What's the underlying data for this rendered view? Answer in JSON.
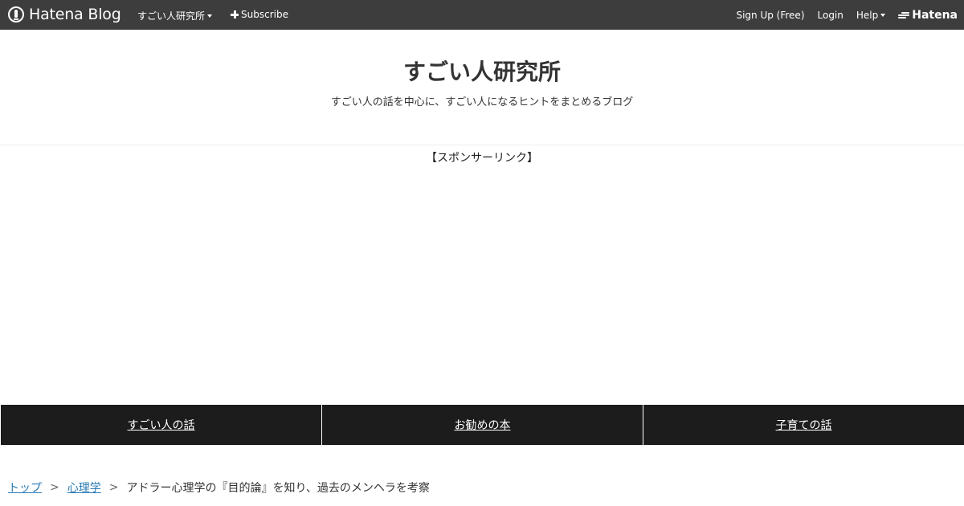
{
  "topbar": {
    "logo_text": "Hatena Blog",
    "blog_menu_label": "すごい人研究所",
    "subscribe_label": "Subscribe",
    "signup_label": "Sign Up (Free)",
    "login_label": "Login",
    "help_label": "Help",
    "hatena_label": "Hatena",
    "bg_color": "#3d3d3d"
  },
  "header": {
    "title": "すごい人研究所",
    "description": "すごい人の話を中心に、すごい人になるヒントをまとめるブログ"
  },
  "ad": {
    "label": "【スポンサーリンク】"
  },
  "category_nav": {
    "items": [
      {
        "label": "すごい人の話"
      },
      {
        "label": "お勧めの本"
      },
      {
        "label": "子育ての話"
      }
    ],
    "bg_color": "#1c1c1c"
  },
  "breadcrumb": {
    "items": [
      {
        "label": "トップ"
      },
      {
        "label": "心理学"
      }
    ],
    "separator": ">",
    "current": "アドラー心理学の『目的論』を知り、過去のメンヘラを考察",
    "link_color": "#2a7bb5"
  }
}
